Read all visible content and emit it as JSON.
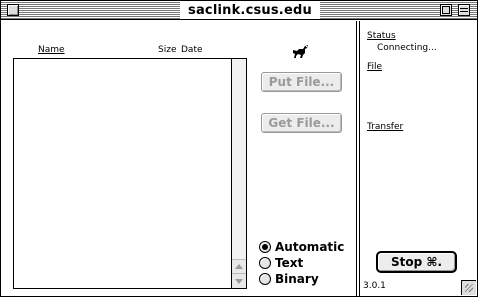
{
  "window": {
    "title": "saclink.csus.edu"
  },
  "file_list": {
    "columns": [
      "Name",
      "Size",
      "Date"
    ]
  },
  "buttons": {
    "put_file": "Put File...",
    "get_file": "Get File...",
    "stop": "Stop  ⌘."
  },
  "mode": {
    "options": [
      "Automatic",
      "Text",
      "Binary"
    ],
    "selected": "Automatic"
  },
  "status_panel": {
    "status_label": "Status",
    "status_text": "Connecting...",
    "file_label": "File",
    "transfer_label": "Transfer",
    "version": "3.0.1"
  },
  "icons": {
    "close": "close-box-icon",
    "zoom": "zoom-box-icon",
    "collapse": "collapse-box-icon",
    "logo": "fetch-dog-icon",
    "grow": "resize-grip-icon"
  },
  "colors": {
    "disabled_text": "#9a9a9a",
    "button_face": "#ececec",
    "stripe": "#777777"
  }
}
